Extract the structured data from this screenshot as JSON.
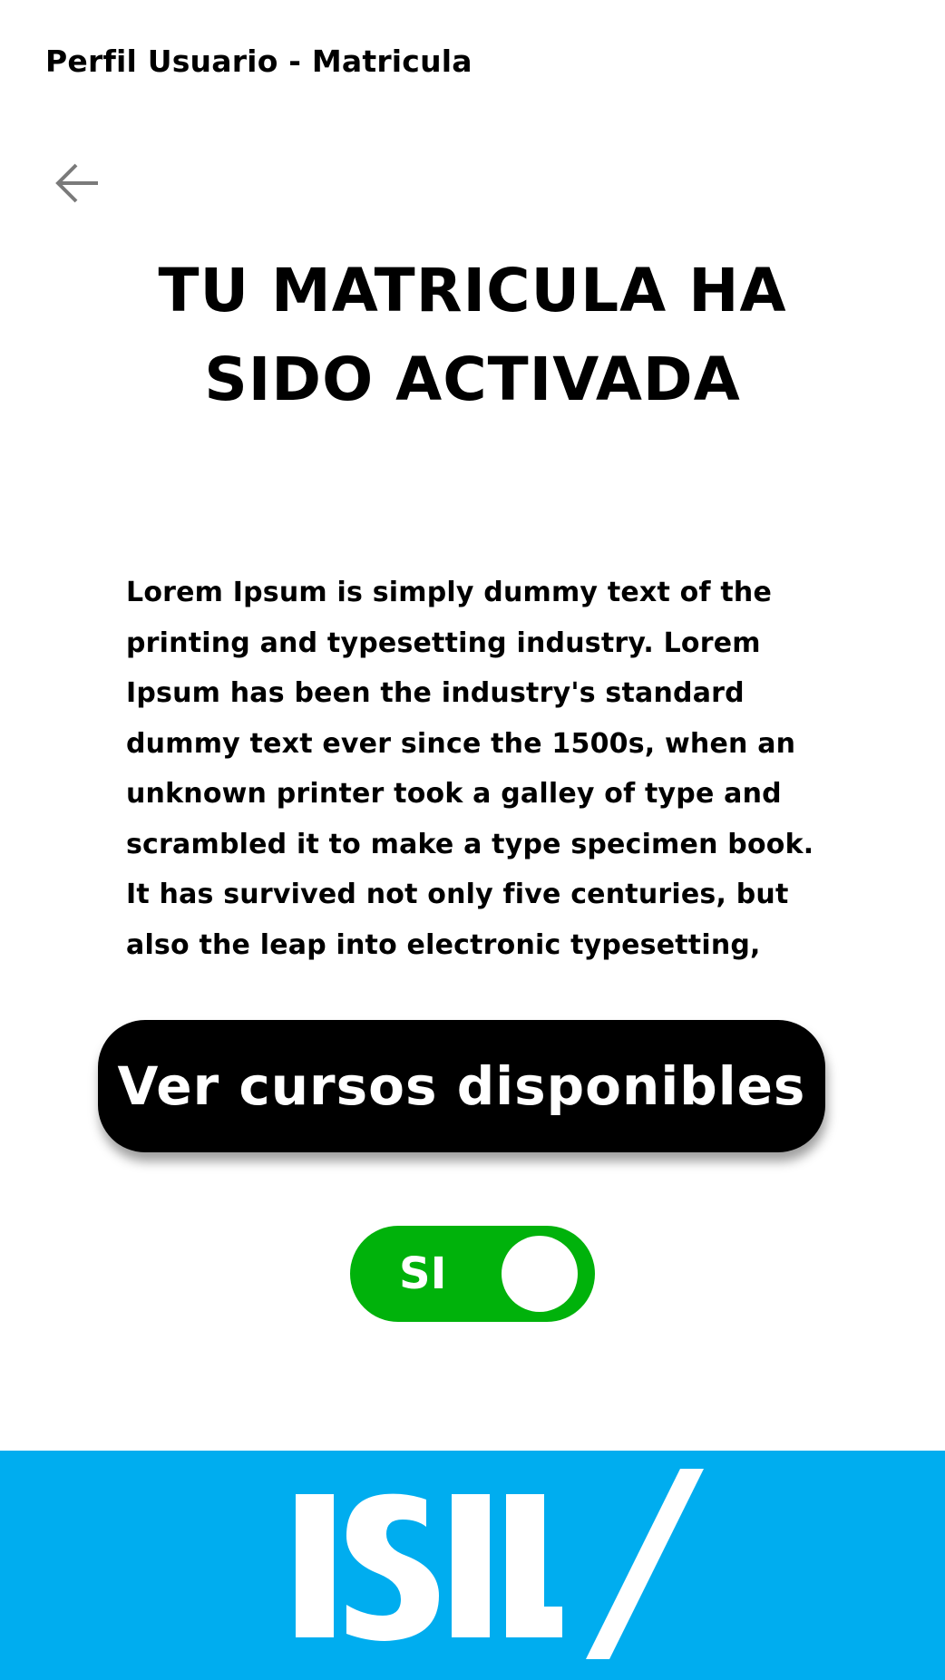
{
  "header": {
    "title": "Perfil Usuario - Matricula",
    "back_icon": "arrow-left-icon"
  },
  "main": {
    "heading_lines": [
      "TU MATRICULA HA",
      "SIDO ACTIVADA"
    ],
    "body_lines": [
      "Lorem Ipsum is simply dummy text of the",
      "printing and typesetting industry. Lorem",
      "Ipsum has been the industry's standard",
      "dummy text ever since the 1500s, when an",
      "unknown printer took a galley of type and",
      "scrambled it to make a type specimen book.",
      "It has survived not only five centuries, but",
      "also the leap into electronic typesetting,"
    ],
    "cta_label": "Ver cursos disponibles",
    "toggle": {
      "label": "SI",
      "on": true
    }
  },
  "footer": {
    "logo_text": "ISIL"
  },
  "colors": {
    "toggle_on": "#00b20b",
    "footer_bg": "#00adef",
    "button_bg": "#000000"
  }
}
